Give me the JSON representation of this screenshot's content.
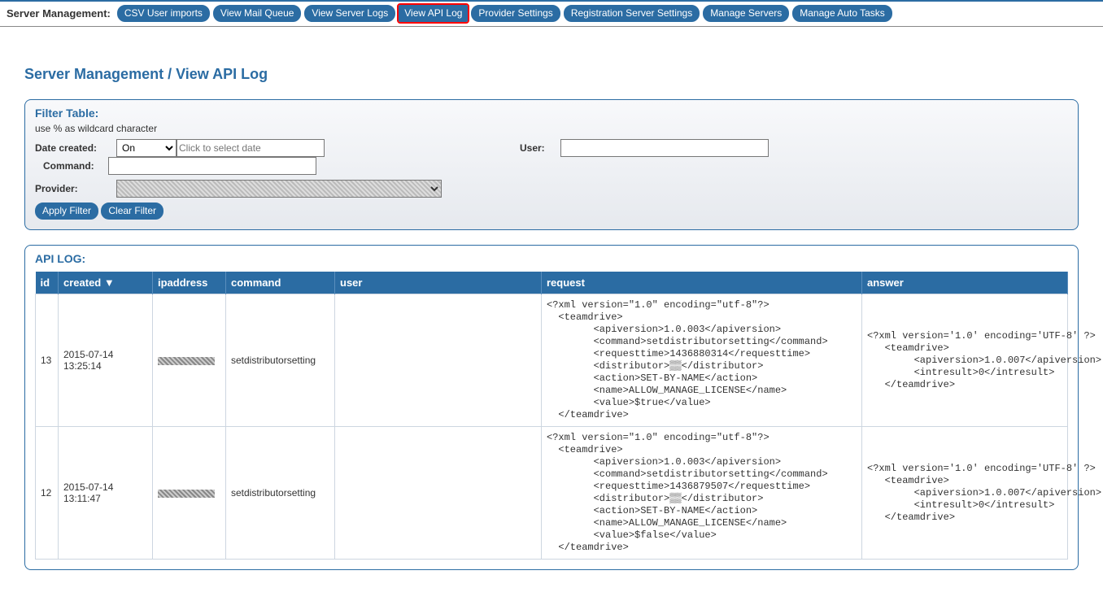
{
  "topbar": {
    "title": "Server Management:",
    "buttons": [
      "CSV User imports",
      "View Mail Queue",
      "View Server Logs",
      "View API Log",
      "Provider Settings",
      "Registration Server Settings",
      "Manage Servers",
      "Manage Auto Tasks"
    ],
    "highlight_index": 3
  },
  "page": {
    "title": "Server Management / View API Log"
  },
  "filter": {
    "head": "Filter Table:",
    "hint": "use % as wildcard character",
    "date_label": "Date created:",
    "date_operator": "On",
    "date_placeholder": "Click to select date",
    "user_label": "User:",
    "user_value": "",
    "command_label": "Command:",
    "command_value": "",
    "provider_label": "Provider:",
    "provider_value": "",
    "apply": "Apply Filter",
    "clear": "Clear Filter"
  },
  "log": {
    "head": "API LOG:",
    "columns": {
      "id": "id",
      "created": "created ▼",
      "ip": "ipaddress",
      "command": "command",
      "user": "user",
      "request": "request",
      "answer": "answer"
    },
    "rows": [
      {
        "id": "13",
        "created": "2015-07-14 13:25:14",
        "ip_redacted": true,
        "command": "setdistributorsetting",
        "user": "",
        "request": "<?xml version=\"1.0\" encoding=\"utf-8\"?>\n  <teamdrive>\n        <apiversion>1.0.003</apiversion>\n        <command>setdistributorsetting</command>\n        <requesttime>1436880314</requesttime>\n        <distributor>▒▒</distributor>\n        <action>SET-BY-NAME</action>\n        <name>ALLOW_MANAGE_LICENSE</name>\n        <value>$true</value>\n  </teamdrive>",
        "answer": "<?xml version='1.0' encoding='UTF-8' ?>\n   <teamdrive>\n        <apiversion>1.0.007</apiversion>\n        <intresult>0</intresult>\n   </teamdrive>"
      },
      {
        "id": "12",
        "created": "2015-07-14 13:11:47",
        "ip_redacted": true,
        "command": "setdistributorsetting",
        "user": "",
        "request": "<?xml version=\"1.0\" encoding=\"utf-8\"?>\n  <teamdrive>\n        <apiversion>1.0.003</apiversion>\n        <command>setdistributorsetting</command>\n        <requesttime>1436879507</requesttime>\n        <distributor>▒▒</distributor>\n        <action>SET-BY-NAME</action>\n        <name>ALLOW_MANAGE_LICENSE</name>\n        <value>$false</value>\n  </teamdrive>",
        "answer": "<?xml version='1.0' encoding='UTF-8' ?>\n   <teamdrive>\n        <apiversion>1.0.007</apiversion>\n        <intresult>0</intresult>\n   </teamdrive>"
      }
    ]
  }
}
